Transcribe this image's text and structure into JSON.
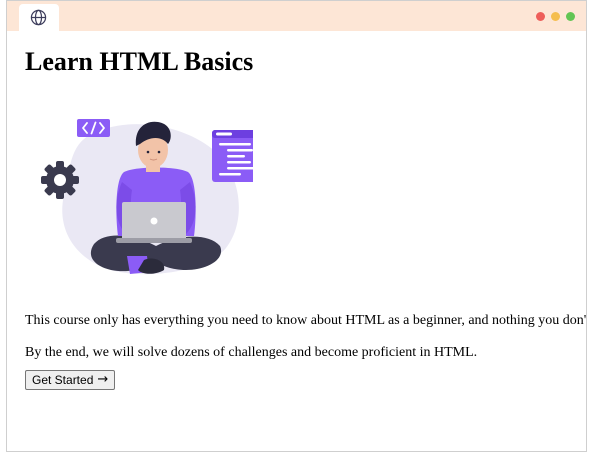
{
  "browser": {
    "tab_icon": "globe-icon",
    "window_controls": [
      {
        "name": "close-dot",
        "color": "#ee5e5a"
      },
      {
        "name": "minimize-dot",
        "color": "#f5be4f"
      },
      {
        "name": "maximize-dot",
        "color": "#62c554"
      }
    ],
    "titlebar_color": "#fde6d6"
  },
  "page": {
    "heading": "Learn HTML Basics",
    "illustration": "person-coding-on-laptop-illustration",
    "accent_color": "#8b5cf6",
    "paragraph1": "This course only has everything you need to know about HTML as a beginner, and nothing you don't.",
    "paragraph2": "By the end, we will solve dozens of challenges and become proficient in HTML.",
    "button_label": "Get Started",
    "button_icon": "arrow-right-icon",
    "button_arrow": "→"
  }
}
